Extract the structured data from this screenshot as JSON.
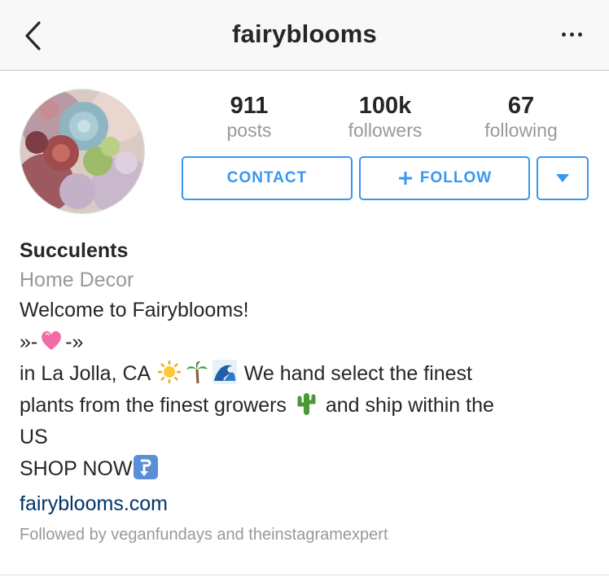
{
  "header": {
    "title": "fairyblooms",
    "back_icon": "chevron-left-icon",
    "more_icon": "more-horizontal-icon"
  },
  "stats": {
    "posts": {
      "value": "911",
      "label": "posts"
    },
    "followers": {
      "value": "100k",
      "label": "followers"
    },
    "following": {
      "value": "67",
      "label": "following"
    }
  },
  "actions": {
    "contact_label": "CONTACT",
    "follow_label": "FOLLOW",
    "dropdown_icon": "caret-down-icon"
  },
  "bio": {
    "name": "Succulents",
    "category": "Home Decor",
    "welcome": "Welcome to Fairyblooms!",
    "divider_left": "»-",
    "divider_right": "-»",
    "location": "in La Jolla, CA",
    "description_1": "We hand select the finest",
    "description_2": "plants from the finest growers",
    "description_3": "and ship within the",
    "description_4": "US",
    "shop": "SHOP NOW",
    "website": "fairyblooms.com",
    "followed_by": "Followed by veganfundays and theinstagramexpert"
  },
  "colors": {
    "accent": "#3897f0",
    "link": "#003569",
    "muted": "#999999",
    "text": "#262626"
  }
}
